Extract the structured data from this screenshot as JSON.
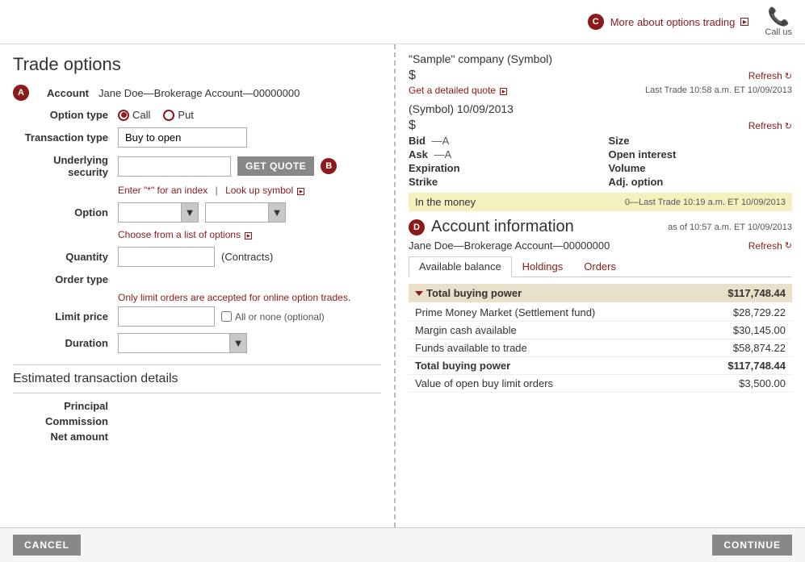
{
  "header": {
    "title": "Trade options",
    "more_about_link": "More about options trading",
    "call_us": "Call us"
  },
  "form": {
    "account_badge": "A",
    "account_label": "Account",
    "account_value": "Jane Doe—Brokerage Account—00000000",
    "option_type_label": "Option type",
    "option_call": "Call",
    "option_put": "Put",
    "transaction_label": "Transaction type",
    "transaction_value": "Buy to open",
    "underlying_label": "Underlying security",
    "get_quote_btn": "GET QUOTE",
    "b_badge": "B",
    "enter_hint": "Enter \"*\" for an index",
    "lookup_link": "Look up symbol",
    "option_label": "Option",
    "choose_link": "Choose from a list of options",
    "quantity_label": "Quantity",
    "contracts_label": "(Contracts)",
    "order_type_label": "Order type",
    "order_note": "Only limit orders are accepted for online option trades.",
    "limit_price_label": "Limit price",
    "all_or_none": "All or none (optional)",
    "duration_label": "Duration"
  },
  "estimated": {
    "title": "Estimated transaction details",
    "principal_label": "Principal",
    "commission_label": "Commission",
    "net_label": "Net amount"
  },
  "footer": {
    "cancel": "CANCEL",
    "continue": "CONTINUE"
  },
  "quote_panel": {
    "company_name": "\"Sample\" company (Symbol)",
    "price_dollar": "$",
    "refresh1": "Refresh",
    "get_detailed_quote": "Get a detailed quote",
    "last_trade1": "Last Trade 10:58 a.m. ET 10/09/2013",
    "symbol_date": "(Symbol) 10/09/2013",
    "price_dollar2": "$",
    "refresh2": "Refresh",
    "bid_label": "Bid",
    "bid_value": "—A",
    "size_label": "Size",
    "ask_label": "Ask",
    "ask_value": "—A",
    "open_interest_label": "Open interest",
    "expiration_label": "Expiration",
    "volume_label": "Volume",
    "strike_label": "Strike",
    "adj_option_label": "Adj. option",
    "in_the_money": "In the money",
    "option_last_trade": "0—Last Trade 10:19 a.m. ET 10/09/2013"
  },
  "account_info": {
    "d_badge": "D",
    "title": "Account information",
    "as_of": "as of 10:57 a.m. ET 10/09/2013",
    "account_name": "Jane Doe—Brokerage Account—00000000",
    "refresh3": "Refresh",
    "tabs": [
      {
        "label": "Available balance",
        "active": true
      },
      {
        "label": "Holdings",
        "active": false
      },
      {
        "label": "Orders",
        "active": false
      }
    ],
    "total_buying_power_label": "Total buying power",
    "total_buying_power_value": "$117,748.44",
    "items": [
      {
        "label": "Prime Money Market (Settlement fund)",
        "value": "$28,729.22",
        "bold": false
      },
      {
        "label": "Margin cash available",
        "value": "$30,145.00",
        "bold": false
      },
      {
        "label": "Funds available to trade",
        "value": "$58,874.22",
        "bold": false
      },
      {
        "label": "Total buying power",
        "value": "$117,748.44",
        "bold": true
      },
      {
        "label": "Value of open buy limit orders",
        "value": "$3,500.00",
        "bold": false
      }
    ]
  }
}
